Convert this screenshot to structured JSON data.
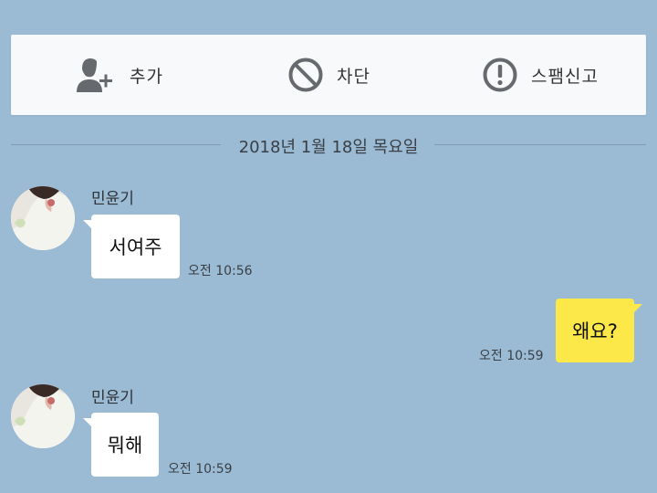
{
  "actions": {
    "add_label": "추가",
    "block_label": "차단",
    "spam_label": "스팸신고"
  },
  "date_separator": "2018년 1월 18일 목요일",
  "messages": [
    {
      "sender": "민윤기",
      "text": "서여주",
      "time": "오전 10:56",
      "direction": "incoming"
    },
    {
      "text": "왜요?",
      "time": "오전 10:59",
      "direction": "outgoing"
    },
    {
      "sender": "민윤기",
      "text": "뭐해",
      "time": "오전 10:59",
      "direction": "incoming"
    }
  ],
  "colors": {
    "background": "#9bbbd4",
    "outgoing_bubble": "#fde84a",
    "incoming_bubble": "#ffffff",
    "icon": "#666a6f"
  },
  "icons": [
    "add-friend-icon",
    "block-icon",
    "spam-report-icon",
    "avatar"
  ]
}
